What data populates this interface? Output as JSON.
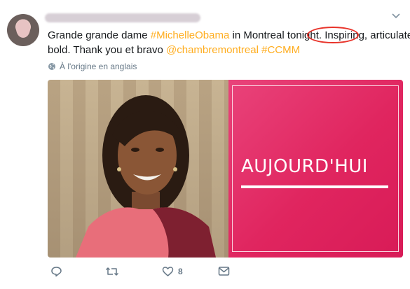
{
  "tweet": {
    "lines": [
      [
        "Grande grande dame ",
        "#MichelleObama",
        " in Montreal tonight. Inspiring, articulate,"
      ],
      [
        "bold. Thank you et bravo  ",
        "@chambremontreal #CCMM",
        ""
      ]
    ]
  },
  "translate_label": "À l'origine en anglais",
  "media": {
    "overlay_text": "AUJOURD'HUI"
  },
  "actions": {
    "like_count": "8"
  },
  "colors": {
    "hashtag": "#ffad1f",
    "magenta": "#e0255f",
    "annotation_circle": "#e8332a"
  }
}
